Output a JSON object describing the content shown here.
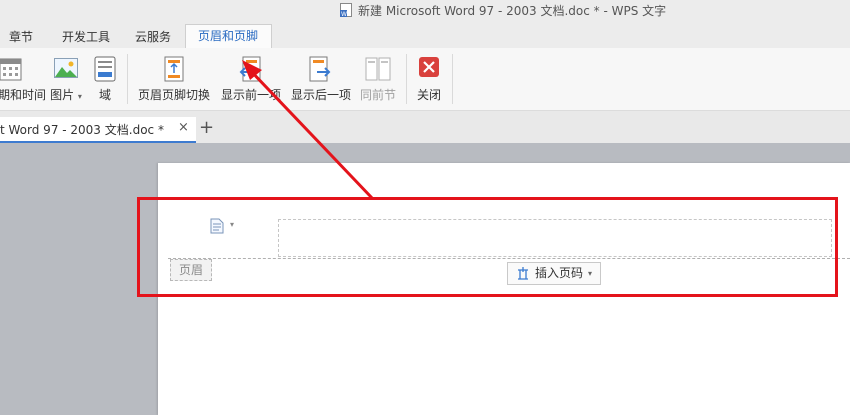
{
  "window": {
    "title": "新建 Microsoft Word 97 - 2003 文档.doc * - WPS 文字"
  },
  "menu_tabs": [
    {
      "label": "章节",
      "active": false
    },
    {
      "label": "开发工具",
      "active": false
    },
    {
      "label": "云服务",
      "active": false
    },
    {
      "label": "页眉和页脚",
      "active": true
    }
  ],
  "ribbon": {
    "datetime_label": "期和时间",
    "picture_label": "图片",
    "field_label": "域",
    "switch_label": "页眉页脚切换",
    "prev_label": "显示前一项",
    "next_label": "显示后一项",
    "same_as_prev_label": "同前节",
    "close_label": "关闭"
  },
  "doc_tabs": {
    "active_name": "t Word 97 - 2003 文档.doc *",
    "close_symbol": "×",
    "add_symbol": "+"
  },
  "document": {
    "header_label": "页眉",
    "insert_page_number_label": "插入页码"
  },
  "colors": {
    "accent_blue": "#2a6bc2",
    "annotation_red": "#e4131b",
    "close_red": "#d9413d"
  }
}
